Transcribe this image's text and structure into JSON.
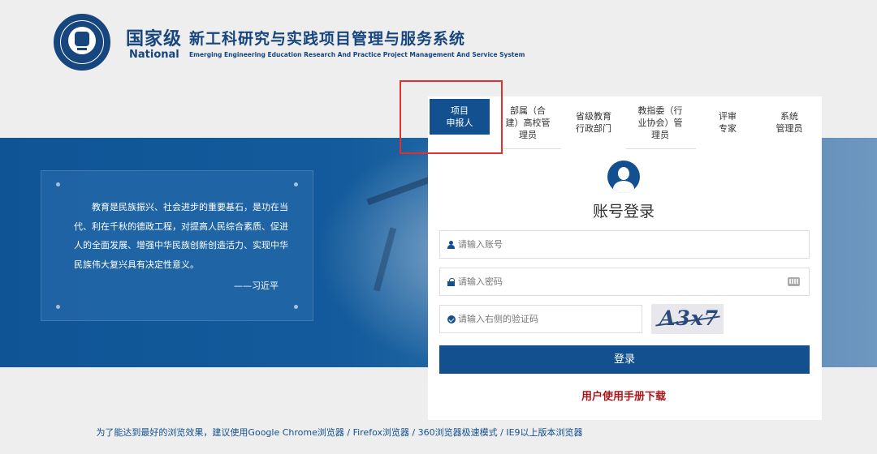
{
  "header": {
    "logo_name": "university-seal",
    "title_national_cn": "国家级",
    "title_system_cn": "新工科研究与实践项目管理与服务系统",
    "title_national_en": "National",
    "title_system_en": "Emerging Engineering Education Research And Practice Project Management And Service System"
  },
  "quote": {
    "text": "教育是民族振兴、社会进步的重要基石，是功在当代、利在千秋的德政工程，对提高人民综合素质、促进人的全面发展、增强中华民族创新创造活力、实现中华民族伟大复兴具有决定性意义。",
    "author": "——习近平"
  },
  "tabs": [
    {
      "label": "项目\n申报人",
      "active": true
    },
    {
      "label": "部属（合\n建）高校管\n理员",
      "active": false
    },
    {
      "label": "省级教育\n行政部门",
      "active": false
    },
    {
      "label": "教指委（行\n业协会）管\n理员",
      "active": false
    },
    {
      "label": "评审\n专家",
      "active": false
    },
    {
      "label": "系统\n管理员",
      "active": false
    }
  ],
  "login": {
    "title": "账号登录",
    "account_placeholder": "请输入账号",
    "password_placeholder": "请输入密码",
    "captcha_placeholder": "请输入右侧的验证码",
    "captcha_text": "A3x7",
    "submit_label": "登录",
    "manual_link": "用户使用手册下载"
  },
  "footer": {
    "note": "为了能达到最好的浏览效果，建议使用Google Chrome浏览器 / Firefox浏览器 / 360浏览器极速模式 / IE9以上版本浏览器"
  },
  "colors": {
    "brand_blue": "#12508f",
    "link_red": "#a8171a",
    "highlight": "#e03030"
  }
}
